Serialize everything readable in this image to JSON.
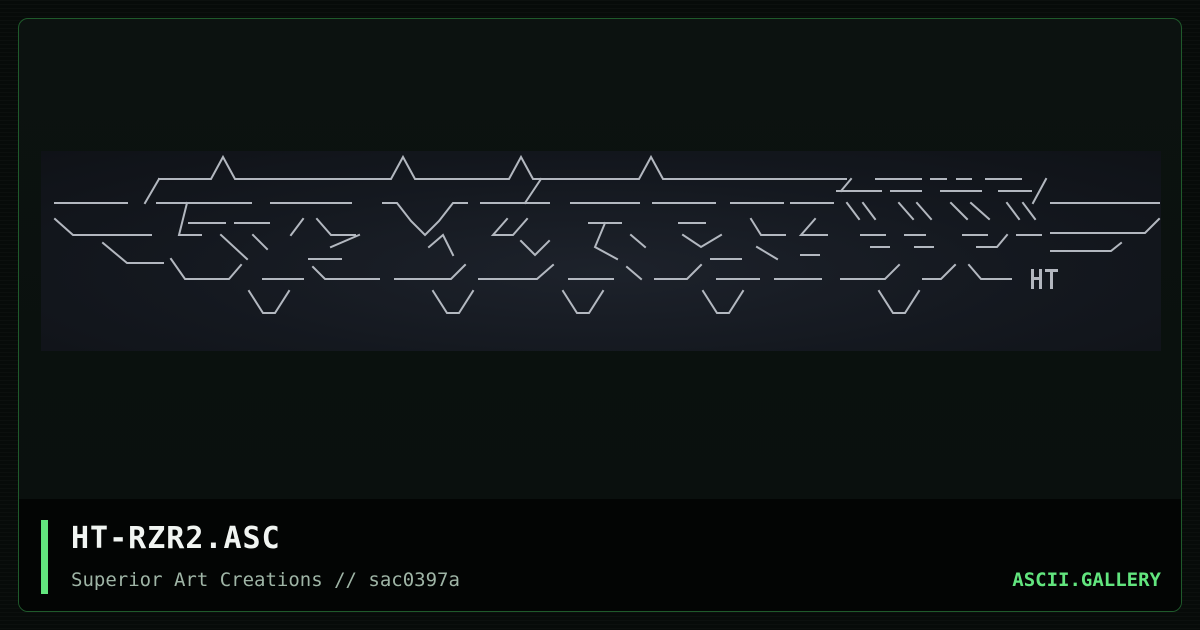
{
  "card": {
    "title": "HT-RZR2.ASC",
    "subtitle": "Superior Art Creations // sac0397a",
    "brand": "ASCII.GALLERY"
  },
  "artwork": {
    "signature": "HT",
    "icon": "ascii-art-logo"
  },
  "colors": {
    "accent": "#62e57e",
    "border": "#1f5a2b",
    "art_stroke": "#c9ced6",
    "art_background": "#171b22"
  }
}
